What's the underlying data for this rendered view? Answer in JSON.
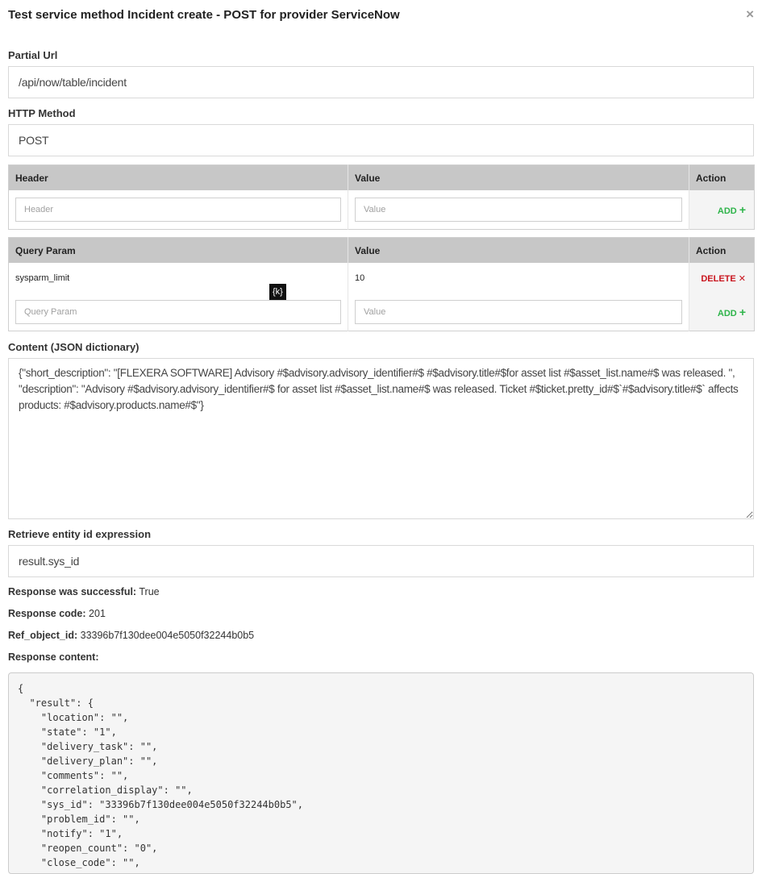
{
  "dialog": {
    "title": "Test service method Incident create - POST for provider ServiceNow",
    "close_glyph": "×"
  },
  "partial_url": {
    "label": "Partial Url",
    "value": "/api/now/table/incident"
  },
  "http_method": {
    "label": "HTTP Method",
    "value": "POST"
  },
  "headers_table": {
    "columns": [
      "Header",
      "Value",
      "Action"
    ],
    "new_row": {
      "key_placeholder": "Header",
      "value_placeholder": "Value",
      "add_label": "ADD",
      "add_icon": "+"
    }
  },
  "query_table": {
    "columns": [
      "Query Param",
      "Value",
      "Action"
    ],
    "rows": [
      {
        "key": "sysparm_limit",
        "value": "10",
        "delete_label": "DELETE",
        "delete_icon": "✕"
      }
    ],
    "new_row": {
      "key_placeholder": "Query Param",
      "value_placeholder": "Value",
      "add_label": "ADD",
      "add_icon": "+"
    }
  },
  "tooltip": "{k}",
  "content": {
    "label": "Content (JSON dictionary)",
    "value": "{\"short_description\": \"[FLEXERA SOFTWARE] Advisory #$advisory.advisory_identifier#$ #$advisory.title#$for asset list #$asset_list.name#$ was released. \", \"description\": \"Advisory #$advisory.advisory_identifier#$ for asset list #$asset_list.name#$ was released. Ticket #$ticket.pretty_id#$`#$advisory.title#$` affects products: #$advisory.products.name#$\"}"
  },
  "entity_expr": {
    "label": "Retrieve entity id expression",
    "value": "result.sys_id"
  },
  "response": {
    "success_label": "Response was successful:",
    "success_value": "True",
    "code_label": "Response code:",
    "code_value": "201",
    "ref_label": "Ref_object_id:",
    "ref_value": "33396b7f130dee004e5050f32244b0b5",
    "content_label": "Response content:",
    "content_text": "{\n  \"result\": {\n    \"location\": \"\",\n    \"state\": \"1\",\n    \"delivery_task\": \"\",\n    \"delivery_plan\": \"\",\n    \"comments\": \"\",\n    \"correlation_display\": \"\",\n    \"sys_id\": \"33396b7f130dee004e5050f32244b0b5\",\n    \"problem_id\": \"\",\n    \"notify\": \"1\",\n    \"reopen_count\": \"0\",\n    \"close_code\": \"\","
  },
  "colors": {
    "add": "#2eb44a",
    "delete": "#c9151e",
    "table_header": "#c7c7c7"
  }
}
